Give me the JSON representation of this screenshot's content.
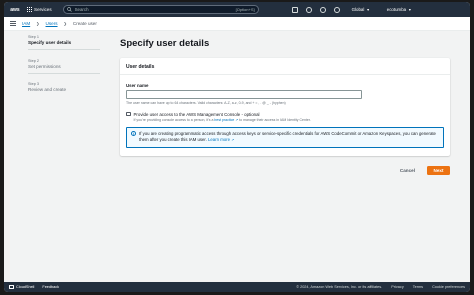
{
  "topnav": {
    "logo": "aws",
    "services_label": "Services",
    "search_placeholder": "Search",
    "search_shortcut": "[Option+S]",
    "region": "Global",
    "account": "ecotumba"
  },
  "breadcrumb": {
    "items": [
      "IAM",
      "Users",
      "Create user"
    ]
  },
  "steps": [
    {
      "num": "Step 1",
      "name": "Specify user details"
    },
    {
      "num": "Step 2",
      "name": "Set permissions"
    },
    {
      "num": "Step 3",
      "name": "Review and create"
    }
  ],
  "page_title": "Specify user details",
  "panel": {
    "header": "User details",
    "field_label": "User name",
    "field_value": "",
    "field_hint": "The user name can have up to 64 characters. Valid characters: A-Z, a-z, 0-9, and + = , . @ _ - (hyphen)",
    "checkbox_label": "Provide user access to the AWS Management Console - optional",
    "checkbox_desc_pre": "If you're providing console access to a person, it's a",
    "checkbox_desc_link": "best practice",
    "checkbox_desc_post": "to manage their access in IAM Identity Center.",
    "info_text": "If you are creating programmatic access through access keys or service-specific credentials for AWS CodeCommit or Amazon Keyspaces, you can generate them after you create this IAM user.",
    "info_link": "Learn more"
  },
  "actions": {
    "cancel": "Cancel",
    "next": "Next"
  },
  "footer": {
    "cloudshell": "CloudShell",
    "feedback": "Feedback",
    "copyright": "© 2024, Amazon Web Services, Inc. or its affiliates.",
    "privacy": "Privacy",
    "terms": "Terms",
    "cookies": "Cookie preferences"
  },
  "colors": {
    "nav_bg": "#232f3e",
    "primary_button": "#ec7211",
    "link": "#0073bb",
    "info_bg": "#f1faff"
  }
}
